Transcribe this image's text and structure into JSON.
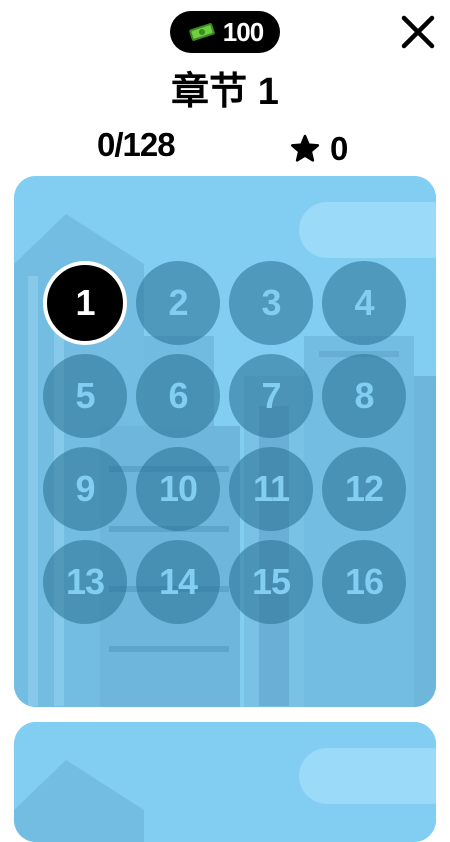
{
  "header": {
    "currency_value": "100",
    "currency_icon": "cash-icon",
    "close_icon": "close-icon"
  },
  "chapter": {
    "title": "章节 1",
    "progress": "0/128",
    "stars": "0"
  },
  "levels": [
    {
      "label": "1",
      "current": true
    },
    {
      "label": "2",
      "current": false
    },
    {
      "label": "3",
      "current": false
    },
    {
      "label": "4",
      "current": false
    },
    {
      "label": "5",
      "current": false
    },
    {
      "label": "6",
      "current": false
    },
    {
      "label": "7",
      "current": false
    },
    {
      "label": "8",
      "current": false
    },
    {
      "label": "9",
      "current": false
    },
    {
      "label": "10",
      "current": false
    },
    {
      "label": "11",
      "current": false
    },
    {
      "label": "12",
      "current": false
    },
    {
      "label": "13",
      "current": false
    },
    {
      "label": "14",
      "current": false
    },
    {
      "label": "15",
      "current": false
    },
    {
      "label": "16",
      "current": false
    }
  ],
  "colors": {
    "card_background": "#82cdf2",
    "current_level": "#000000",
    "locked_level": "#2670918c"
  }
}
